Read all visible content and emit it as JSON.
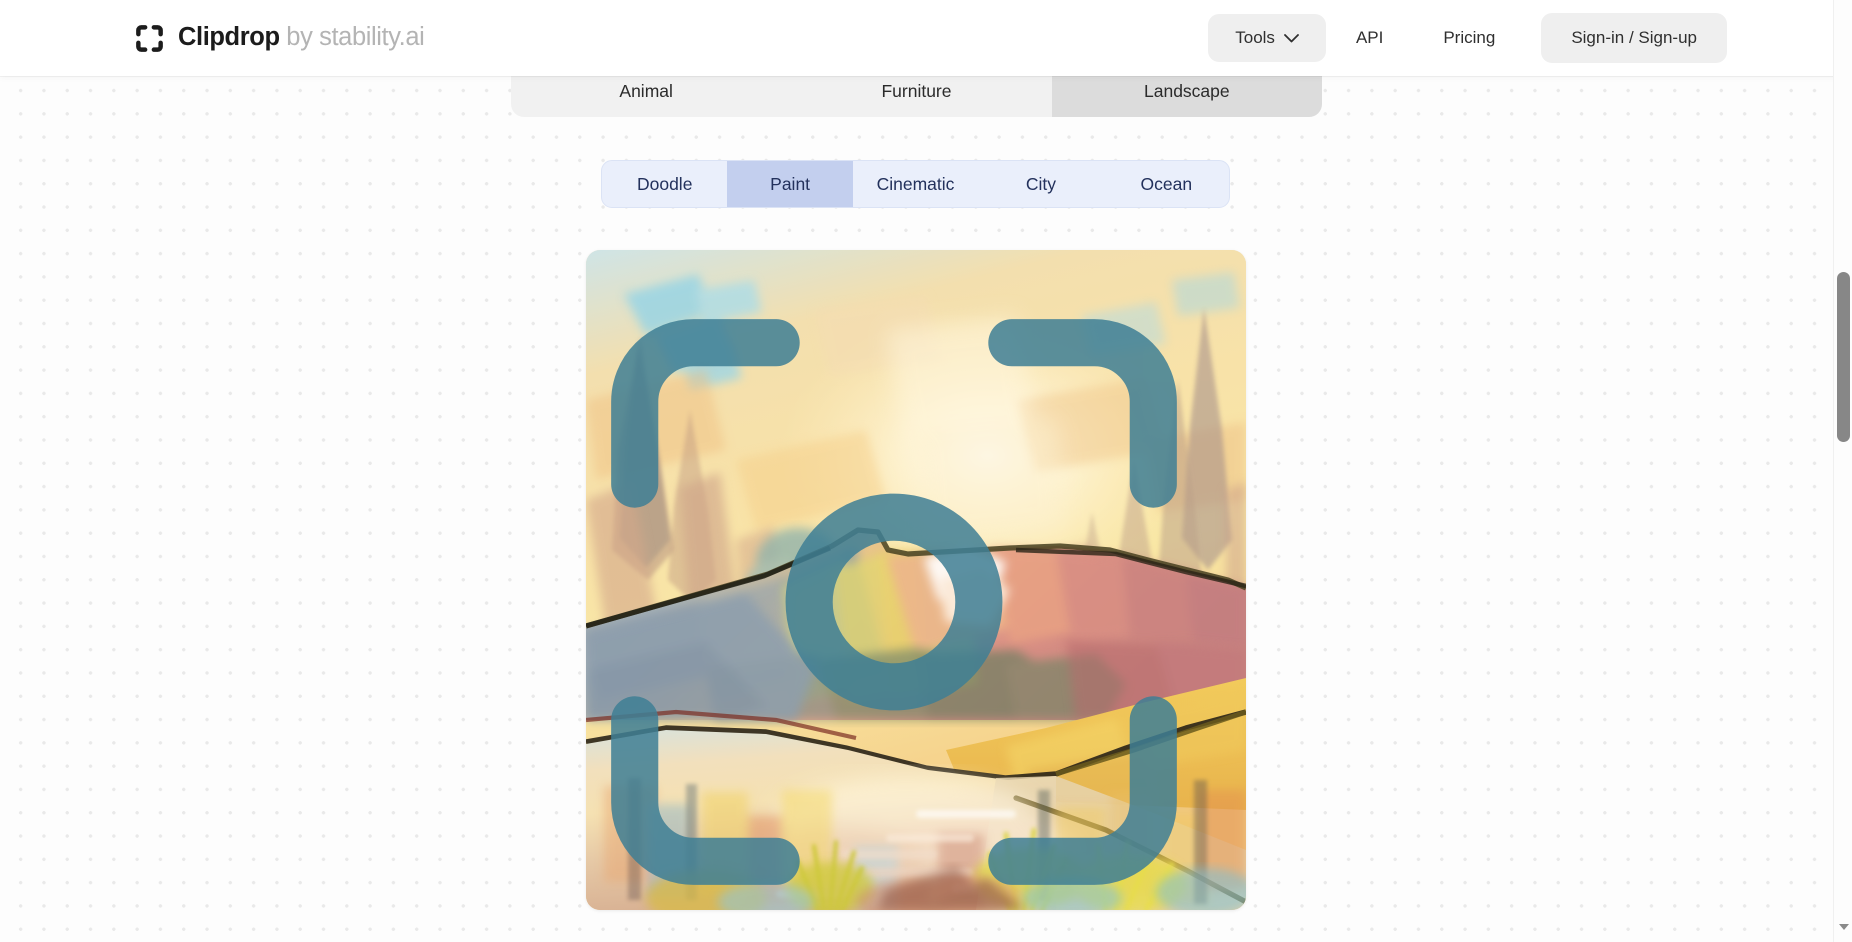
{
  "header": {
    "logo_icon": "crop-frame-icon",
    "brand": "Clipdrop",
    "byline": " by stability.ai",
    "nav": {
      "tools_label": "Tools",
      "tools_chevron_icon": "chevron-down-icon",
      "api_label": "API",
      "pricing_label": "Pricing",
      "signin_label": "Sign-in / Sign-up"
    }
  },
  "category_tabs": {
    "items": [
      {
        "label": "Animal",
        "active": false
      },
      {
        "label": "Furniture",
        "active": false
      },
      {
        "label": "Landscape",
        "active": true
      }
    ],
    "selected": "Landscape"
  },
  "style_tabs": {
    "items": [
      {
        "label": "Doodle",
        "active": false
      },
      {
        "label": "Paint",
        "active": true
      },
      {
        "label": "Cinematic",
        "active": false
      },
      {
        "label": "City",
        "active": false
      },
      {
        "label": "Ocean",
        "active": false
      }
    ],
    "selected": "Paint"
  },
  "result_image": {
    "alt": "Impressionist painted landscape with golden sky, mountain ridge, autumn trees and a reflective lake",
    "magnify_icon": "focus-frame-icon",
    "magnify_icon_color": "#3f7f95"
  },
  "scrollbar": {
    "thumb_name": "vertical-scroll-thumb",
    "down_arrow_icon": "chevron-down-icon"
  },
  "colors": {
    "page_bg": "#fdfdfd",
    "dot_grid": "#e9e9e9",
    "header_bg": "#ffffff",
    "pill_bg": "#efefef",
    "category_tab_bg": "#f1f1f1",
    "category_tab_active": "#dcdcdc",
    "style_tab_bg": "#eaeffb",
    "style_tab_active": "#c3cfee",
    "style_tab_text": "#23315c",
    "scrollbar_thumb": "#878787"
  }
}
